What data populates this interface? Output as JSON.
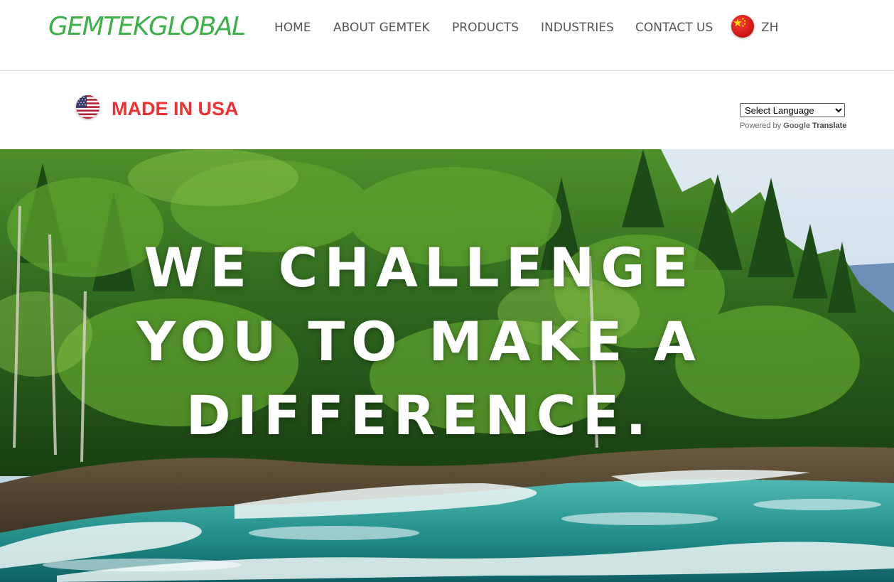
{
  "header": {
    "logo_text": "GEMTEKGLOBAL",
    "nav": [
      {
        "label": "HOME"
      },
      {
        "label": "ABOUT GEMTEK"
      },
      {
        "label": "PRODUCTS"
      },
      {
        "label": "INDUSTRIES"
      },
      {
        "label": "CONTACT US"
      }
    ],
    "language_link": "ZH",
    "language_flag_icon": "china-flag-icon"
  },
  "banner": {
    "flag_icon": "usa-flag-icon",
    "made_in_text": "MADE IN USA",
    "translate_select_value": "Select Language",
    "powered_by_prefix": "Powered by",
    "google_text": "Google",
    "translate_text": "Translate"
  },
  "hero": {
    "headline_lines": [
      "WE CHALLENGE",
      "YOU TO MAKE A",
      "DIFFERENCE."
    ]
  },
  "colors": {
    "logo_green": "#3db04a",
    "nav_text": "#555555",
    "made_in_red": "#ee3233",
    "headline_white": "#ffffff"
  }
}
